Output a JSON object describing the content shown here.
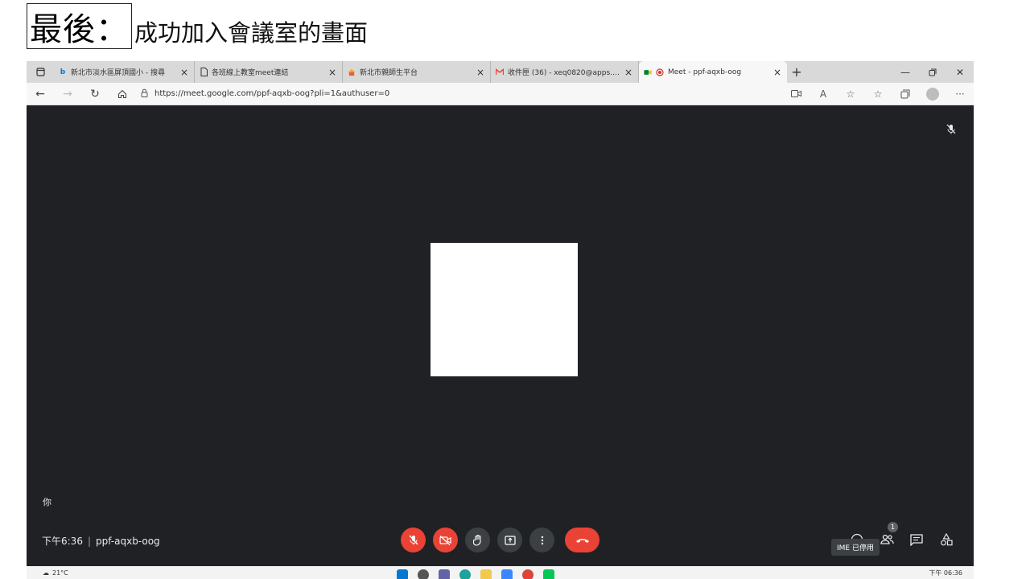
{
  "slide": {
    "title": "最後：",
    "subtitle": "成功加入會議室的畫面"
  },
  "browser": {
    "tabs": [
      {
        "label": "新北市淡水區屏頂國小 - 搜尋",
        "icon": "bing-icon",
        "active": false
      },
      {
        "label": "各班線上教室meet連結",
        "icon": "page-icon",
        "active": false
      },
      {
        "label": "新北市親師生平台",
        "icon": "portal-icon",
        "active": false
      },
      {
        "label": "收件匣 (36) - xeq0820@apps.ntpc",
        "icon": "gmail-icon",
        "active": false
      },
      {
        "label": "Meet - ppf-aqxb-oog",
        "icon": "meet-icon",
        "active": true
      }
    ],
    "address": {
      "url": "https://meet.google.com/ppf-aqxb-oog?pli=1&authuser=0"
    }
  },
  "meet": {
    "self_label": "你",
    "time": "下午6:36",
    "separator": "|",
    "meeting_code": "ppf-aqxb-oog",
    "participant_count": "1",
    "ime_tooltip": "IME 已停用"
  },
  "taskbar": {
    "weather": "21°C",
    "clock": "下午 06:36"
  },
  "colors": {
    "meet_background": "#202124",
    "control_red": "#ea4335",
    "control_gray": "#3c4043"
  }
}
